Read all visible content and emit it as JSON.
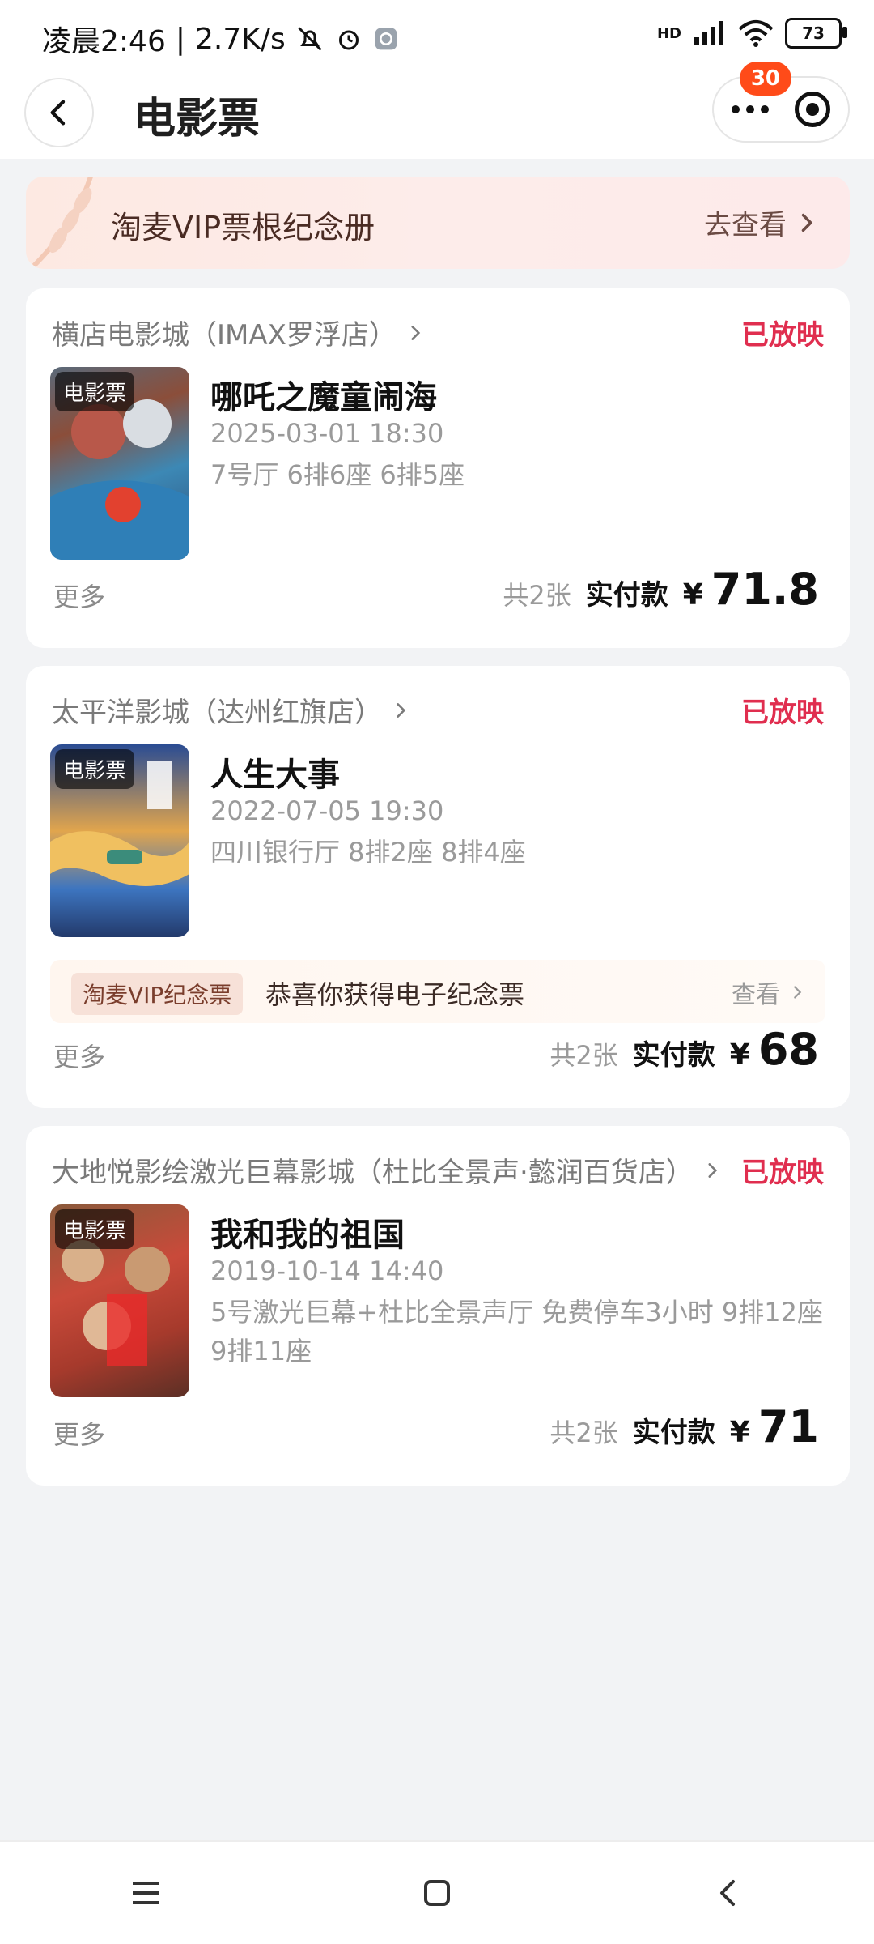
{
  "status_bar": {
    "time": "凌晨2:46",
    "speed": "2.7K/s",
    "hd_label": "HD",
    "battery": "73"
  },
  "header": {
    "title": "电影票",
    "badge_count": "30"
  },
  "banner": {
    "title": "淘麦VIP票根纪念册",
    "action": "去查看"
  },
  "orders": [
    {
      "cinema": "横店电影城（IMAX罗浮店）",
      "status": "已放映",
      "poster_tag": "电影票",
      "movie": "哪吒之魔童闹海",
      "time": "2025-03-01 18:30",
      "seats": "7号厅 6排6座 6排5座",
      "more": "更多",
      "qty": "共2张",
      "paid_label": "实付款",
      "currency": "¥",
      "amount": "71.8"
    },
    {
      "cinema": "太平洋影城（达州红旗店）",
      "status": "已放映",
      "poster_tag": "电影票",
      "movie": "人生大事",
      "time": "2022-07-05 19:30",
      "seats": "四川银行厅 8排2座 8排4座",
      "souvenir_badge": "淘麦VIP纪念票",
      "souvenir_text": "恭喜你获得电子纪念票",
      "souvenir_action": "查看",
      "more": "更多",
      "qty": "共2张",
      "paid_label": "实付款",
      "currency": "¥",
      "amount": "68"
    },
    {
      "cinema": "大地悦影绘激光巨幕影城（杜比全景声·懿润百货店）",
      "status": "已放映",
      "poster_tag": "电影票",
      "movie": "我和我的祖国",
      "time": "2019-10-14 14:40",
      "seats": "5号激光巨幕+杜比全景声厅 免费停车3小时 9排12座 9排11座",
      "more": "更多",
      "qty": "共2张",
      "paid_label": "实付款",
      "currency": "¥",
      "amount": "71"
    }
  ]
}
